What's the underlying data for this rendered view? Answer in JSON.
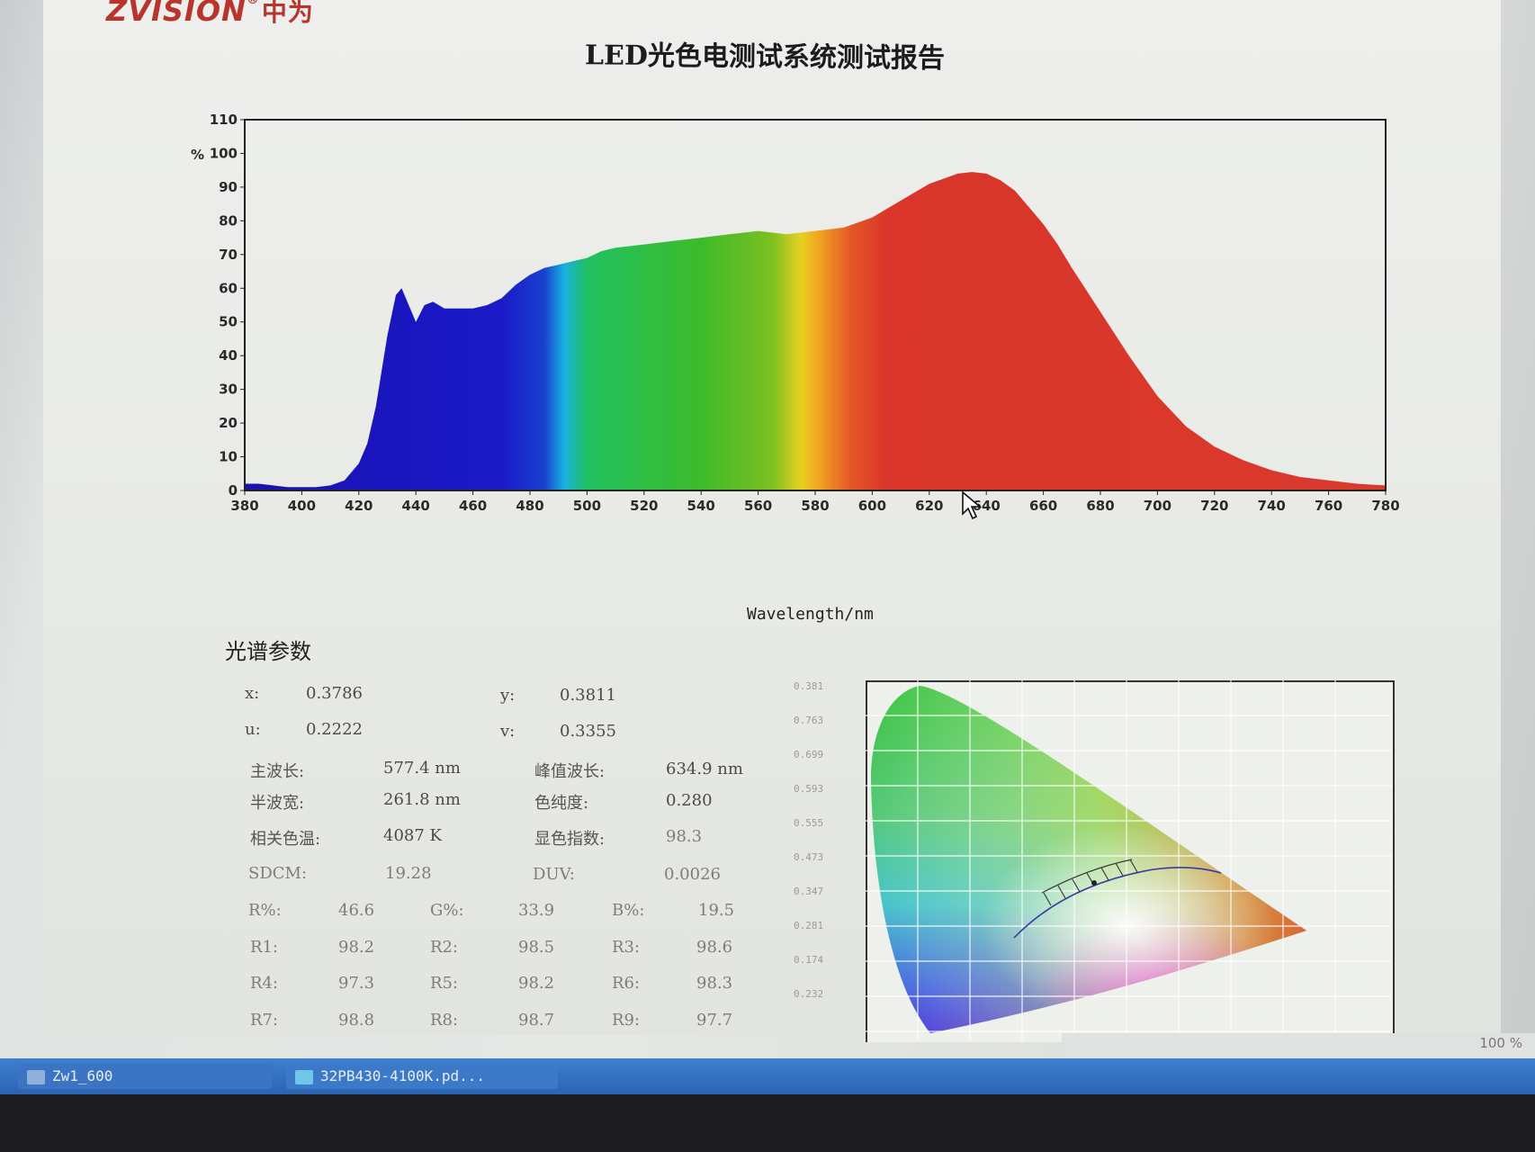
{
  "brand": {
    "name": "ZVISION",
    "reg": "®",
    "cn": "中为"
  },
  "report_title": "LED光色电测试系统测试报告",
  "chart_data": {
    "type": "area",
    "title": "",
    "xlabel": "Wavelength/nm",
    "ylabel": "%",
    "xlim": [
      380,
      780
    ],
    "ylim": [
      0,
      110
    ],
    "x_ticks": [
      380,
      400,
      420,
      440,
      460,
      480,
      500,
      520,
      540,
      560,
      580,
      600,
      620,
      640,
      660,
      680,
      700,
      720,
      740,
      760,
      780
    ],
    "y_ticks": [
      0,
      10,
      20,
      30,
      40,
      50,
      60,
      70,
      80,
      90,
      100,
      110
    ],
    "grid": false,
    "fill": "visible-spectrum gradient",
    "x": [
      380,
      385,
      390,
      395,
      400,
      405,
      410,
      415,
      420,
      423,
      426,
      430,
      433,
      435,
      437,
      440,
      443,
      446,
      450,
      455,
      460,
      465,
      470,
      475,
      480,
      485,
      490,
      495,
      500,
      505,
      510,
      520,
      530,
      540,
      550,
      560,
      565,
      570,
      575,
      580,
      585,
      590,
      600,
      610,
      620,
      630,
      635,
      640,
      645,
      650,
      655,
      660,
      665,
      670,
      680,
      690,
      700,
      710,
      720,
      730,
      740,
      750,
      760,
      770,
      780
    ],
    "y": [
      2,
      2,
      1.5,
      1,
      1,
      1,
      1.5,
      3,
      8,
      14,
      25,
      46,
      58,
      60,
      56,
      50,
      55,
      56,
      54,
      54,
      54,
      55,
      57,
      61,
      64,
      66,
      67,
      68,
      69,
      71,
      72,
      73,
      74,
      75,
      76,
      77,
      76.5,
      76,
      76.5,
      77,
      77.5,
      78,
      81,
      86,
      91,
      94,
      94.5,
      94,
      92,
      89,
      84,
      79,
      73,
      66,
      53,
      40,
      28,
      19,
      13,
      9,
      6,
      4,
      3,
      2,
      1.5
    ]
  },
  "spectral_params": {
    "heading": "光谱参数",
    "x_label": "x:",
    "x_value": "0.3786",
    "y_label": "y:",
    "y_value": "0.3811",
    "u_label": "u:",
    "u_value": "0.2222",
    "v_label": "v:",
    "v_value": "0.3355",
    "dominant_label": "主波长:",
    "dominant_value": "577.4 nm",
    "peak_label": "峰值波长:",
    "peak_value": "634.9 nm",
    "fwhm_label": "半波宽:",
    "fwhm_value": "261.8 nm",
    "purity_label": "色纯度:",
    "purity_value": "0.280",
    "cct_label": "相关色温:",
    "cct_value": "4087 K",
    "cri_label": "显色指数:",
    "cri_value": "98.3",
    "sdcm_label": "SDCM:",
    "sdcm_value": "19.28",
    "duv_label": "DUV:",
    "duv_value": "0.0026",
    "r_pct_label": "R%:",
    "r_pct_value": "46.6",
    "g_pct_label": "G%:",
    "g_pct_value": "33.9",
    "b_pct_label": "B%:",
    "b_pct_value": "19.5",
    "r1_label": "R1:",
    "r1_value": "98.2",
    "r2_label": "R2:",
    "r2_value": "98.5",
    "r3_label": "R3:",
    "r3_value": "98.6",
    "r4_label": "R4:",
    "r4_value": "97.3",
    "r5_label": "R5:",
    "r5_value": "98.2",
    "r6_label": "R6:",
    "r6_value": "98.3",
    "r7_label": "R7:",
    "r7_value": "98.8",
    "r8_label": "R8:",
    "r8_value": "98.7",
    "r9_label": "R9:",
    "r9_value": "97.7"
  },
  "cie_ticks": [
    "0.381",
    "0.763",
    "0.699",
    "0.593",
    "0.555",
    "0.473",
    "0.347",
    "0.281",
    "0.174",
    "0.232"
  ],
  "taskbar": {
    "items": [
      {
        "label": "Zw1_600"
      },
      {
        "label": "32PB430-4100K.pd..."
      }
    ],
    "zoom": "100 %"
  },
  "colors": {
    "taskbar": "#2a64b3",
    "brand": "#b7352d"
  }
}
